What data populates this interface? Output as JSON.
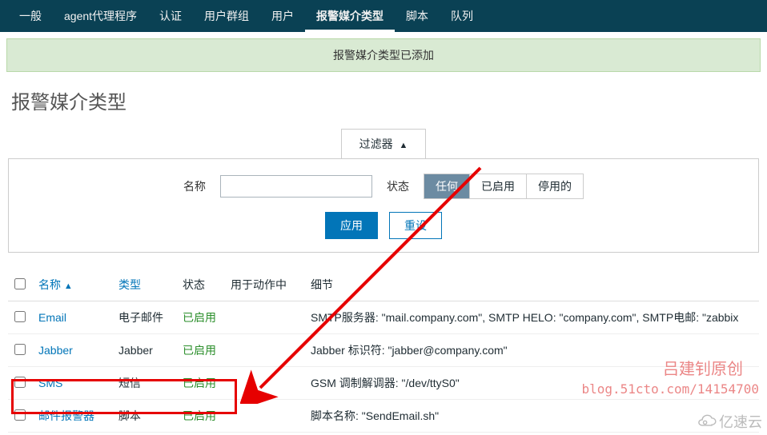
{
  "tabs": [
    "一般",
    "agent代理程序",
    "认证",
    "用户群组",
    "用户",
    "报警媒介类型",
    "脚本",
    "队列"
  ],
  "activeTabIndex": 5,
  "alert_message": "报警媒介类型已添加",
  "page_title": "报警媒介类型",
  "filter": {
    "tab_label": "过滤器",
    "name_label": "名称",
    "name_value": "",
    "status_label": "状态",
    "status_options": [
      "任何",
      "已启用",
      "停用的"
    ],
    "status_selected": 0,
    "apply_label": "应用",
    "reset_label": "重设"
  },
  "columns": {
    "name": "名称",
    "type": "类型",
    "status": "状态",
    "used_in": "用于动作中",
    "details": "细节"
  },
  "rows": [
    {
      "name": "Email",
      "type": "电子邮件",
      "status": "已启用",
      "details": "SMTP服务器: \"mail.company.com\", SMTP HELO: \"company.com\", SMTP电邮: \"zabbix"
    },
    {
      "name": "Jabber",
      "type": "Jabber",
      "status": "已启用",
      "details": "Jabber 标识符: \"jabber@company.com\""
    },
    {
      "name": "SMS",
      "type": "短信",
      "status": "已启用",
      "details": "GSM 调制解调器: \"/dev/ttyS0\""
    },
    {
      "name": "邮件报警器",
      "type": "脚本",
      "status": "已启用",
      "details": "脚本名称: \"SendEmail.sh\""
    }
  ],
  "watermark": {
    "line1": "吕建钊原创",
    "line2": "blog.51cto.com/14154700"
  },
  "corner_logo": "亿速云"
}
